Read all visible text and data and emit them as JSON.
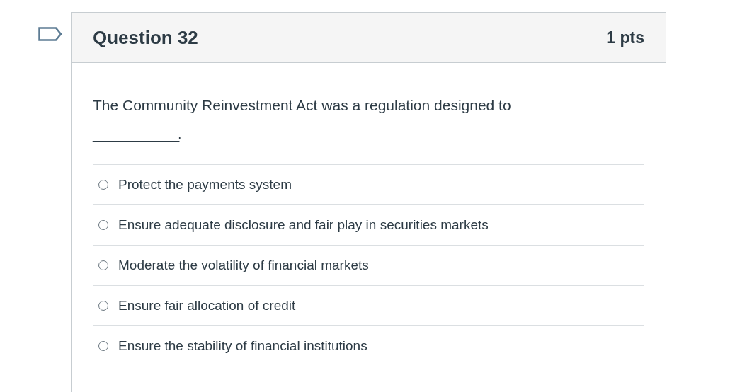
{
  "question": {
    "title": "Question 32",
    "points": "1 pts",
    "flagged": false,
    "text": "The Community Reinvestment Act was a regulation designed to",
    "blank": "_______________.",
    "answers": [
      {
        "label": "Protect the payments system",
        "selected": false
      },
      {
        "label": "Ensure adequate disclosure and fair play in securities markets",
        "selected": false
      },
      {
        "label": "Moderate the volatility of financial markets",
        "selected": false
      },
      {
        "label": "Ensure fair allocation of credit",
        "selected": false
      },
      {
        "label": "Ensure the stability of financial institutions",
        "selected": false
      }
    ]
  }
}
